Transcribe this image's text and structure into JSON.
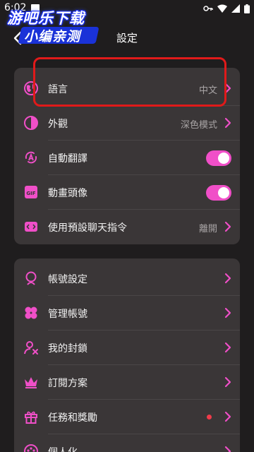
{
  "status_bar": {
    "time": "6:02",
    "icons": [
      "key-icon",
      "wifi-icon",
      "signal-icon",
      "battery-icon"
    ]
  },
  "watermark": {
    "line1": "游吧乐下载",
    "line2": "小编亲测"
  },
  "header": {
    "title": "設定",
    "back_icon": "chevron-left-icon"
  },
  "colors": {
    "accent": "#f04fc8",
    "card_bg": "#3a3637",
    "page_bg": "#1f1d1e",
    "highlight": "#e01a1a",
    "dot": "#f03b4a"
  },
  "section1": {
    "items": [
      {
        "label": "語言",
        "value": "中文",
        "icon": "globe-icon",
        "control": "chevron"
      },
      {
        "label": "外觀",
        "value": "深色模式",
        "icon": "theme-icon",
        "control": "chevron"
      },
      {
        "label": "自動翻譯",
        "icon": "translate-icon",
        "control": "toggle",
        "on": true
      },
      {
        "label": "動畫頭像",
        "icon": "gif-icon",
        "control": "toggle",
        "on": true
      },
      {
        "label": "使用預設聊天指令",
        "value": "離開",
        "icon": "command-icon",
        "control": "chevron"
      }
    ]
  },
  "section2": {
    "items": [
      {
        "label": "帳號設定",
        "icon": "account-icon",
        "control": "chevron"
      },
      {
        "label": "管理帳號",
        "icon": "manage-accounts-icon",
        "control": "chevron"
      },
      {
        "label": "我的封鎖",
        "icon": "block-user-icon",
        "control": "chevron"
      },
      {
        "label": "訂閱方案",
        "icon": "crown-icon",
        "control": "chevron"
      },
      {
        "label": "任務和獎勵",
        "icon": "gift-icon",
        "control": "chevron",
        "notification_dot": true
      },
      {
        "label": "個人化",
        "icon": "palette-icon",
        "control": "chevron"
      }
    ]
  }
}
